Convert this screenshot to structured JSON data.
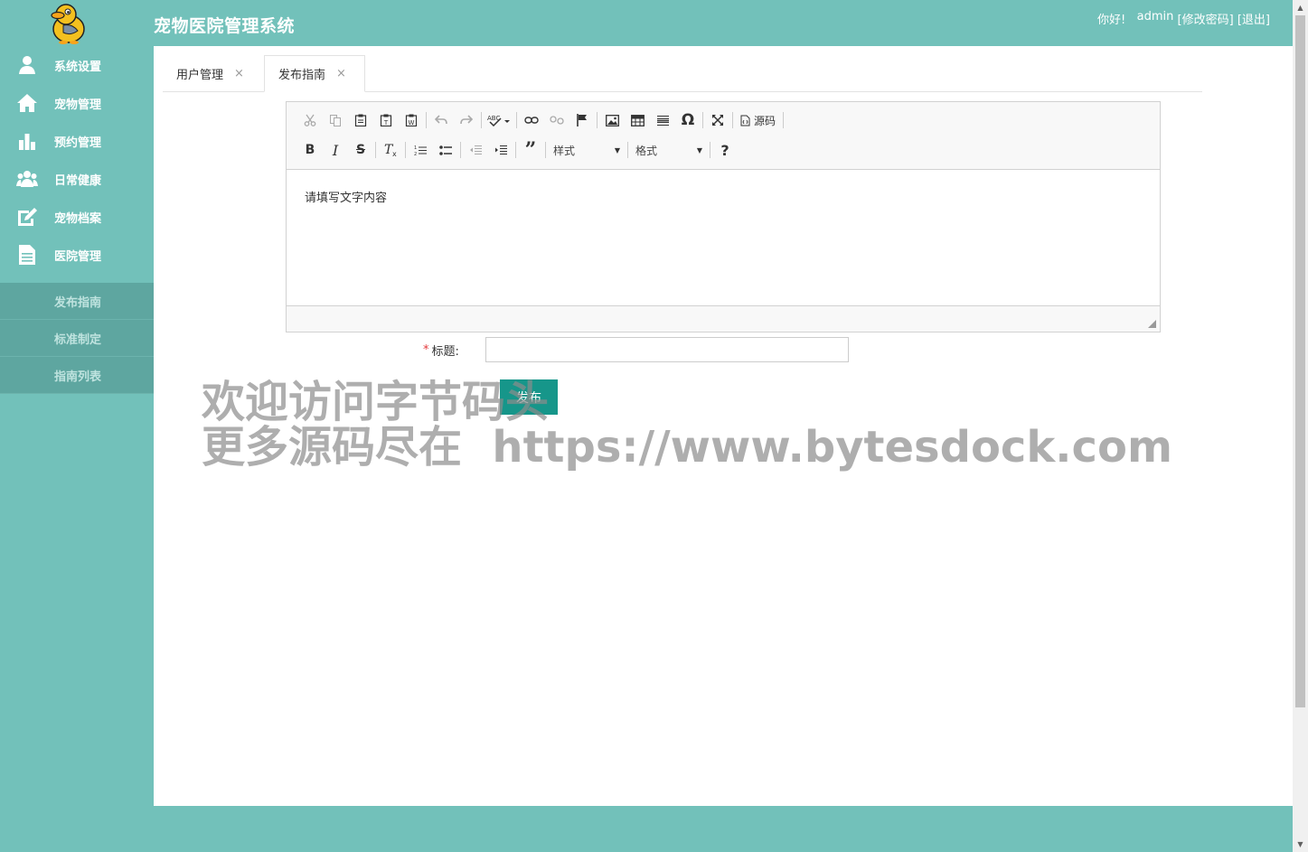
{
  "header": {
    "title": "宠物医院管理系统",
    "greeting": "你好!",
    "username": "admin",
    "change_password": "[修改密码]",
    "logout": "[退出]"
  },
  "sidebar": {
    "items": [
      {
        "label": "系统设置",
        "icon": "user-icon"
      },
      {
        "label": "宠物管理",
        "icon": "home-icon"
      },
      {
        "label": "预约管理",
        "icon": "bar-chart-icon"
      },
      {
        "label": "日常健康",
        "icon": "group-icon"
      },
      {
        "label": "宠物档案",
        "icon": "edit-icon"
      },
      {
        "label": "医院管理",
        "icon": "document-icon"
      }
    ],
    "submenu": [
      {
        "label": "发布指南"
      },
      {
        "label": "标准制定"
      },
      {
        "label": "指南列表"
      }
    ]
  },
  "tabs": [
    {
      "label": "用户管理",
      "close": "×"
    },
    {
      "label": "发布指南",
      "close": "×",
      "active": true
    }
  ],
  "editor": {
    "toolbar": {
      "source_label": "源码",
      "style_combo": "样式",
      "format_combo": "格式",
      "help": "?"
    },
    "content": "请填写文字内容"
  },
  "form": {
    "required_mark": "*",
    "title_label": "标题:",
    "title_value": "",
    "submit_label": "发布"
  },
  "watermark": {
    "line1": "欢迎访问字节码头",
    "line2": "更多源码尽在  https://www.bytesdock.com"
  },
  "colors": {
    "sidebar_bg": "#72c1ba",
    "submenu_bg": "#5ea6a0",
    "button_bg": "#16968a"
  }
}
